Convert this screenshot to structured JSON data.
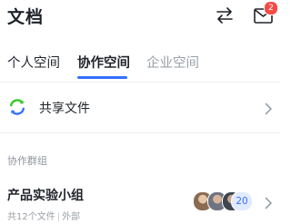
{
  "header": {
    "title": "文档",
    "swap_icon": "swap-arrows-icon",
    "inbox_icon": "mail-icon",
    "inbox_badge": "2"
  },
  "tabs": [
    {
      "label": "个人空间",
      "state": "default"
    },
    {
      "label": "协作空间",
      "state": "active"
    },
    {
      "label": "企业空间",
      "state": "disabled"
    }
  ],
  "shared_files": {
    "label": "共享文件",
    "icon": "sync-icon"
  },
  "groups_section": {
    "label": "协作群组",
    "items": [
      {
        "name": "产品实验小组",
        "file_count": "共12个文件",
        "scope": "外部",
        "member_count": "20"
      }
    ]
  },
  "colors": {
    "accent": "#3370ff",
    "badge": "#f54a45",
    "sync_green": "#34c724",
    "sync_blue": "#3370ff"
  }
}
